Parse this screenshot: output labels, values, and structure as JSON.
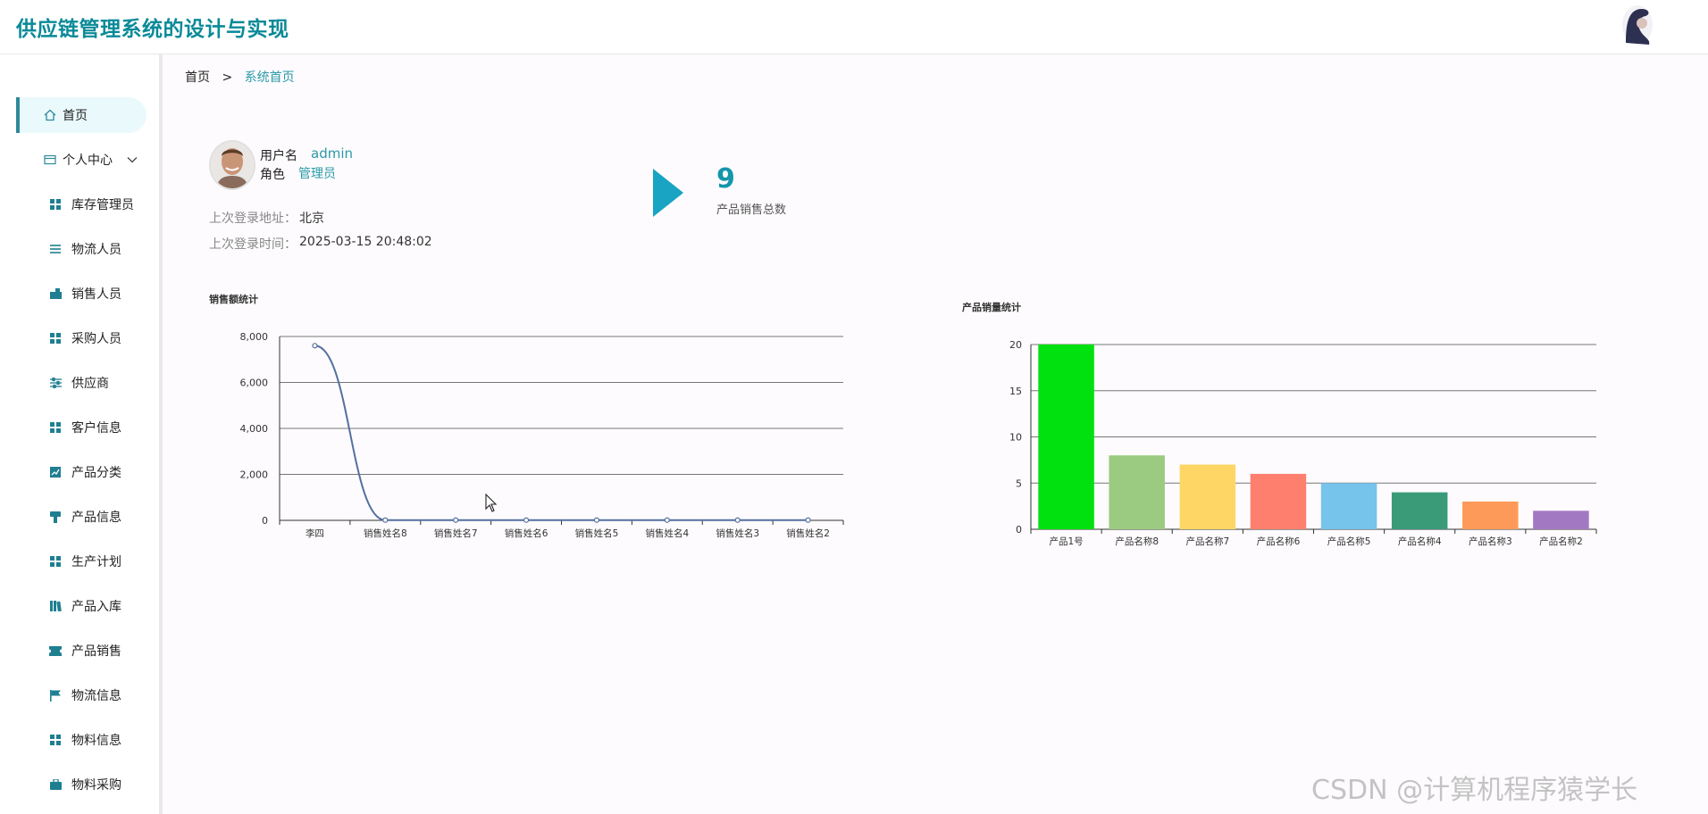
{
  "header": {
    "title": "供应链管理系统的设计与实现"
  },
  "sidebar": {
    "items": [
      {
        "label": "首页",
        "icon": "home-icon",
        "active": true
      },
      {
        "label": "个人中心",
        "icon": "id-card-icon",
        "expandable": true
      },
      {
        "label": "库存管理员",
        "icon": "grid-icon"
      },
      {
        "label": "物流人员",
        "icon": "list-icon"
      },
      {
        "label": "销售人员",
        "icon": "wallet-icon"
      },
      {
        "label": "采购人员",
        "icon": "grid-icon"
      },
      {
        "label": "供应商",
        "icon": "sliders-icon"
      },
      {
        "label": "客户信息",
        "icon": "grid-icon"
      },
      {
        "label": "产品分类",
        "icon": "trend-icon"
      },
      {
        "label": "产品信息",
        "icon": "hammer-icon"
      },
      {
        "label": "生产计划",
        "icon": "grid-icon"
      },
      {
        "label": "产品入库",
        "icon": "book-icon"
      },
      {
        "label": "产品销售",
        "icon": "ticket-icon"
      },
      {
        "label": "物流信息",
        "icon": "flag-icon"
      },
      {
        "label": "物料信息",
        "icon": "grid-icon"
      },
      {
        "label": "物料采购",
        "icon": "briefcase-icon"
      }
    ]
  },
  "breadcrumb": {
    "home": "首页",
    "separator": ">",
    "current": "系统首页"
  },
  "user": {
    "username_label": "用户名",
    "username": "admin",
    "role_label": "角色",
    "role": "管理员",
    "last_location_label": "上次登录地址：",
    "last_location": "北京",
    "last_time_label": "上次登录时间：",
    "last_time": "2025-03-15 20:48:02"
  },
  "stat": {
    "value": "9",
    "label": "产品销售总数"
  },
  "watermark": "CSDN @计算机程序猿学长",
  "colors": {
    "accent": "#0a8a98",
    "link": "#2a9aa8",
    "stat": "#1596ab"
  },
  "chart_data": [
    {
      "type": "line",
      "title": "销售额统计",
      "categories": [
        "李四",
        "销售姓名8",
        "销售姓名7",
        "销售姓名6",
        "销售姓名5",
        "销售姓名4",
        "销售姓名3",
        "销售姓名2"
      ],
      "values": [
        7600,
        10,
        10,
        10,
        10,
        10,
        10,
        10
      ],
      "ylim": [
        0,
        8000
      ],
      "yticks": [
        "0",
        "2,000",
        "4,000",
        "6,000",
        "8,000"
      ],
      "grid": true,
      "color": "#5470a0"
    },
    {
      "type": "bar",
      "title": "产品销量统计",
      "categories": [
        "产品1号",
        "产品名称8",
        "产品名称7",
        "产品名称6",
        "产品名称5",
        "产品名称4",
        "产品名称3",
        "产品名称2"
      ],
      "values": [
        20,
        8,
        7,
        6,
        5,
        4,
        3,
        2
      ],
      "colors": [
        "#00e10f",
        "#9bcb80",
        "#fdd665",
        "#fe7f6e",
        "#76c3ec",
        "#3a9b78",
        "#fe9a59",
        "#a378c3"
      ],
      "ylim": [
        0,
        20
      ],
      "yticks": [
        "0",
        "5",
        "10",
        "15",
        "20"
      ],
      "grid": true
    }
  ]
}
